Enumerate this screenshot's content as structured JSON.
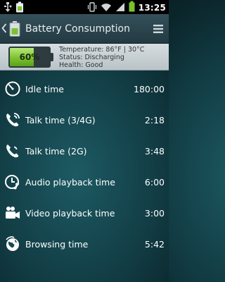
{
  "status_bar": {
    "time": "13:25",
    "left_icons": [
      "usb-icon",
      "battery-app-notification-icon"
    ],
    "right_icons": [
      "vibrate-icon",
      "wifi-icon",
      "signal-icon",
      "battery-icon"
    ]
  },
  "header": {
    "title": "Battery Consumption",
    "back_icon": "chevron-left-icon",
    "menu_icon": "menu-icon"
  },
  "battery": {
    "percent_text": "60%",
    "level": 0.6,
    "temperature": "Temperature: 86°F | 30°C",
    "status": "Status: Discharging",
    "health": "Health: Good"
  },
  "rows": [
    {
      "icon": "timer-icon",
      "label": "Idle time",
      "value": "180:00"
    },
    {
      "icon": "phone-4g-icon",
      "label": "Talk time (3/4G)",
      "value": "2:18"
    },
    {
      "icon": "phone-2g-icon",
      "label": "Talk time (2G)",
      "value": "3:48"
    },
    {
      "icon": "music-clock-icon",
      "label": "Audio playback time",
      "value": "6:00"
    },
    {
      "icon": "video-camera-icon",
      "label": "Video playback time",
      "value": "3:00"
    },
    {
      "icon": "globe-icon",
      "label": "Browsing time",
      "value": "5:42"
    }
  ],
  "colors": {
    "accent_green": "#7cc22f",
    "panel_grey": "#c8d0d3",
    "background_teal": "#123c44"
  }
}
